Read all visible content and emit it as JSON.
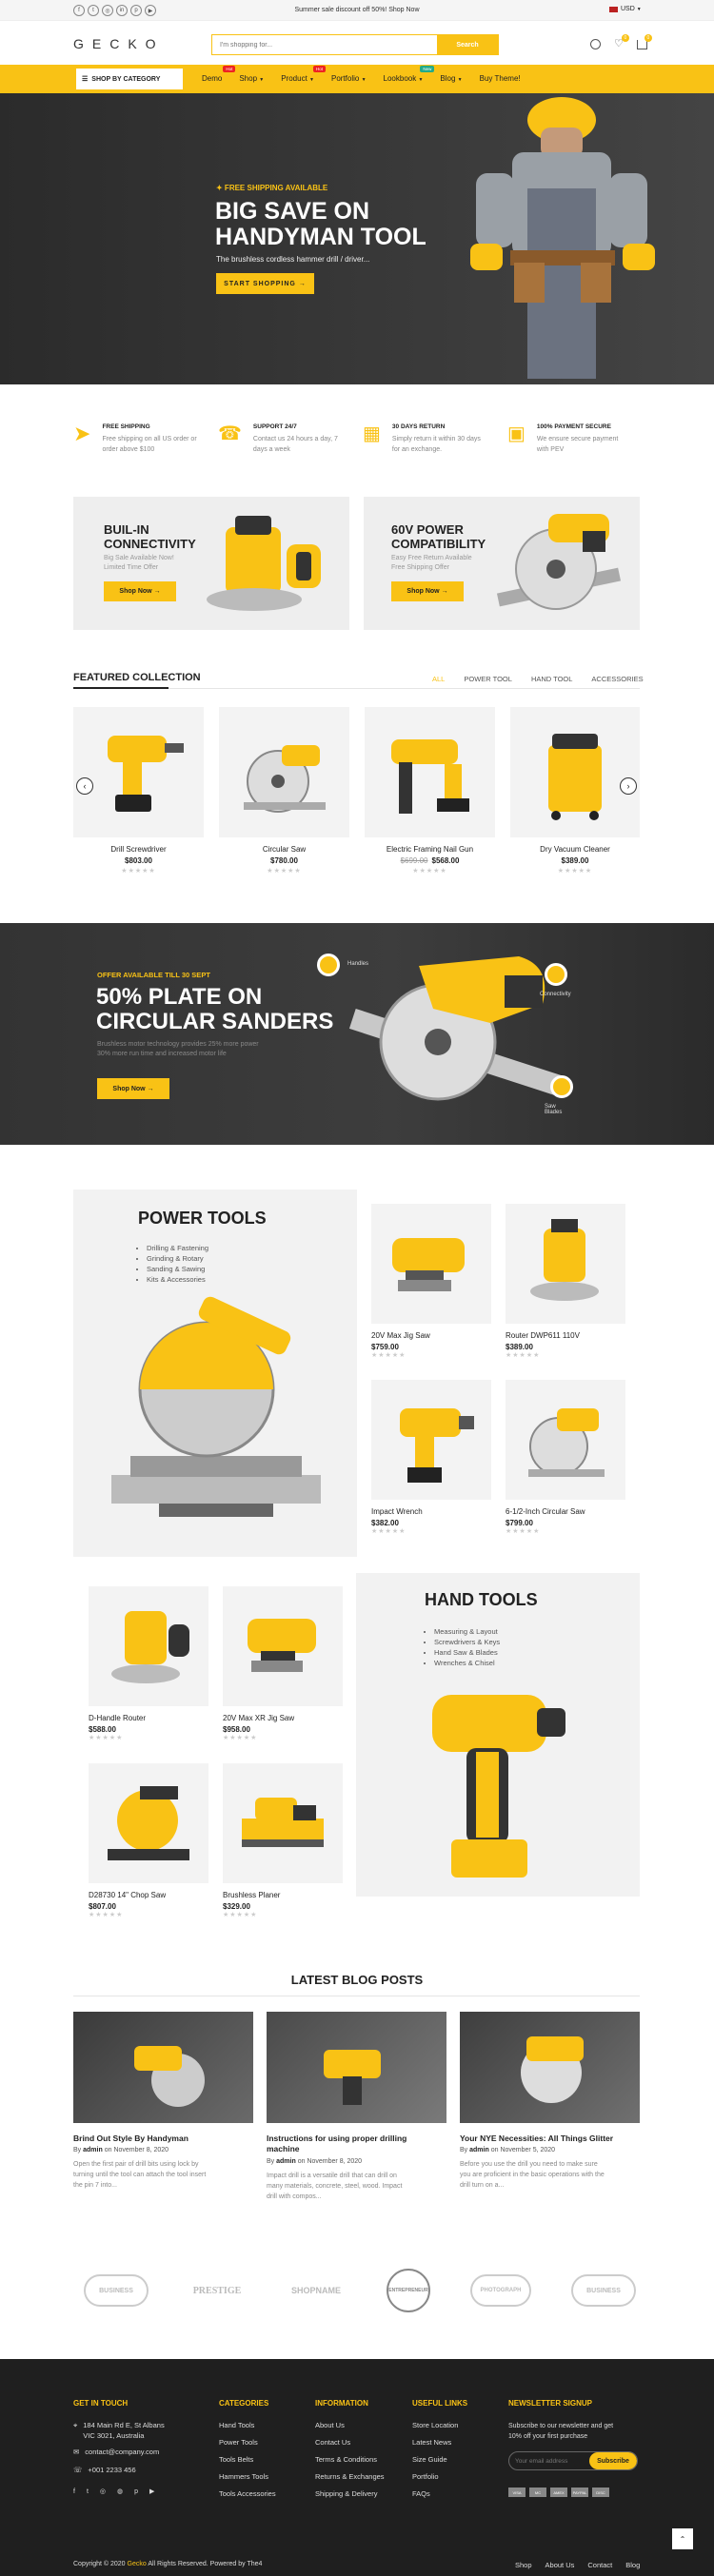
{
  "topbar": {
    "promo": "Summer sale discount off 50%! Shop Now",
    "currency": "USD",
    "socials": [
      "facebook-icon",
      "twitter-icon",
      "instagram-icon",
      "linkedin-icon",
      "pinterest-icon",
      "youtube-icon"
    ]
  },
  "header": {
    "logo": "GECKO",
    "search_placeholder": "I'm shopping for...",
    "search_button": "Search",
    "cart_count": "0",
    "wishlist_count": "0"
  },
  "nav": {
    "category_label": "SHOP BY CATEGORY",
    "items": [
      {
        "label": "Demo",
        "badge": "Hot"
      },
      {
        "label": "Shop",
        "badge": ""
      },
      {
        "label": "Product",
        "badge": "Hot"
      },
      {
        "label": "Portfolio",
        "badge": ""
      },
      {
        "label": "Lookbook",
        "badge": "New"
      },
      {
        "label": "Blog",
        "badge": ""
      },
      {
        "label": "Buy Theme!",
        "badge": ""
      }
    ]
  },
  "hero": {
    "kicker": "✦ FREE SHIPPING AVAILABLE",
    "title_1": "BIG SAVE ON",
    "title_2": "HANDYMAN TOOL",
    "subtitle": "The brushless cordless hammer drill / driver...",
    "button": "START SHOPPING →"
  },
  "features": [
    {
      "title": "FREE SHIPPING",
      "desc": "Free shipping on all US order or order above $100"
    },
    {
      "title": "SUPPORT 24/7",
      "desc": "Contact us 24 hours a day, 7 days a week"
    },
    {
      "title": "30 DAYS RETURN",
      "desc": "Simply return it within 30 days for an exchange."
    },
    {
      "title": "100% PAYMENT SECURE",
      "desc": "We ensure secure payment with PEV"
    }
  ],
  "promos": [
    {
      "title_1": "BUIL-IN",
      "title_2": "CONNECTIVITY",
      "desc_1": "Big Sale Available Now!",
      "desc_2": "Limited Time Offer",
      "button": "Shop Now →"
    },
    {
      "title_1": "60V POWER",
      "title_2": "COMPATIBILITY",
      "desc_1": "Easy Free Return Available",
      "desc_2": "Free Shipping Offer",
      "button": "Shop Now →"
    }
  ],
  "featured": {
    "title": "FEATURED COLLECTION",
    "tabs": [
      "ALL",
      "POWER TOOL",
      "HAND TOOL",
      "ACCESSORIES"
    ],
    "products": [
      {
        "name": "Drill Screwdriver",
        "old_price": "",
        "price": "$803.00"
      },
      {
        "name": "Circular Saw",
        "old_price": "",
        "price": "$780.00"
      },
      {
        "name": "Electric Framing Nail Gun",
        "old_price": "$699.00",
        "price": "$568.00"
      },
      {
        "name": "Dry Vacuum Cleaner",
        "old_price": "",
        "price": "$389.00"
      }
    ]
  },
  "offer": {
    "kicker": "OFFER AVAILABLE TILL 30 SEPT",
    "title_1": "50% PLATE ON",
    "title_2": "CIRCULAR SANDERS",
    "desc_1": "Brushless motor technology provides 25% more power",
    "desc_2": "30% more run time and increased motor life",
    "button": "Shop Now →",
    "callouts": [
      "Handles",
      "Connectivity",
      "Saw Blades"
    ]
  },
  "power_tools": {
    "title": "POWER TOOLS",
    "bullets": [
      "Drilling & Fastening",
      "Grinding & Rotary",
      "Sanding & Sawing",
      "Kits & Accessories"
    ],
    "products": [
      {
        "name": "20V Max Jig Saw",
        "price": "$759.00"
      },
      {
        "name": "Router DWP611 110V",
        "price": "$389.00"
      },
      {
        "name": "Impact Wrench",
        "price": "$382.00"
      },
      {
        "name": "6-1/2-Inch Circular Saw",
        "price": "$799.00"
      }
    ]
  },
  "hand_tools": {
    "title": "HAND TOOLS",
    "bullets": [
      "Measuring & Layout",
      "Screwdrivers & Keys",
      "Hand Saw & Blades",
      "Wrenches & Chisel"
    ],
    "products": [
      {
        "name": "D-Handle Router",
        "price": "$588.00"
      },
      {
        "name": "20V Max XR Jig Saw",
        "price": "$958.00"
      },
      {
        "name": "D28730 14\" Chop Saw",
        "price": "$807.00"
      },
      {
        "name": "Brushless Planer",
        "price": "$329.00"
      }
    ]
  },
  "blog": {
    "title": "LATEST BLOG POSTS",
    "posts": [
      {
        "title_1": "Brind Out Style By Handyman",
        "title_2": "",
        "by": "By",
        "author": "admin",
        "on": "on",
        "date": "November 8, 2020",
        "excerpt_1": "Open the first pair of drill bits using lock by",
        "excerpt_2": "turning until the tool can attach the tool insert",
        "excerpt_3": "the pin 7 into..."
      },
      {
        "title_1": "Instructions for using proper drilling",
        "title_2": "machine",
        "by": "By",
        "author": "admin",
        "on": "on",
        "date": "November 8, 2020",
        "excerpt_1": "Impact drill is a versatile drill that can drill on",
        "excerpt_2": "many materials, concrete, steel, wood. Impact",
        "excerpt_3": "drill with compos..."
      },
      {
        "title_1": "Your NYE Necessities: All Things Glitter",
        "title_2": "",
        "by": "By",
        "author": "admin",
        "on": "on",
        "date": "November 5, 2020",
        "excerpt_1": "Before you use the drill you need to make sure",
        "excerpt_2": "you are proficient in the basic operations with the",
        "excerpt_3": "drill turn on a..."
      }
    ]
  },
  "brands": [
    "BUSINESS",
    "PRESTIGE",
    "SHOPNAME",
    "ENTREPRENEUR",
    "PHOTOGRAPH",
    "BUSINESS"
  ],
  "footer": {
    "contact": {
      "title": "GET IN TOUCH",
      "address_1": "184 Main Rd E, St Albans",
      "address_2": "VIC 3021, Australia",
      "email": "contact@company.com",
      "phone": "+001 2233 456"
    },
    "categories": {
      "title": "CATEGORIES",
      "items": [
        "Hand Tools",
        "Power Tools",
        "Tools Belts",
        "Hammers Tools",
        "Tools Accessories"
      ]
    },
    "information": {
      "title": "INFORMATION",
      "items": [
        "About Us",
        "Contact Us",
        "Terms & Conditions",
        "Returns & Exchanges",
        "Shipping & Delivery"
      ]
    },
    "useful": {
      "title": "USEFUL LINKS",
      "items": [
        "Store Location",
        "Latest News",
        "Size Guide",
        "Portfolio",
        "FAQs"
      ]
    },
    "newsletter": {
      "title": "NEWSLETTER SIGNUP",
      "text_1": "Subscribe to our newsletter and get",
      "text_2": "10% off your first purchase",
      "placeholder": "Your email address",
      "button": "Subscribe"
    },
    "payments": [
      "VISA",
      "MC",
      "AMEX",
      "PAYPAL",
      "DISC"
    ],
    "copyright_pre": "Copyright © 2020",
    "copyright_brand": "Gecko",
    "copyright_post": "All Rights Reserved. Powered by The4",
    "bottom_links": [
      "Shop",
      "About Us",
      "Contact",
      "Blog"
    ]
  },
  "colors": {
    "accent": "#f9c215",
    "dark": "#2e2e2e",
    "footer": "#1e1e1e"
  }
}
